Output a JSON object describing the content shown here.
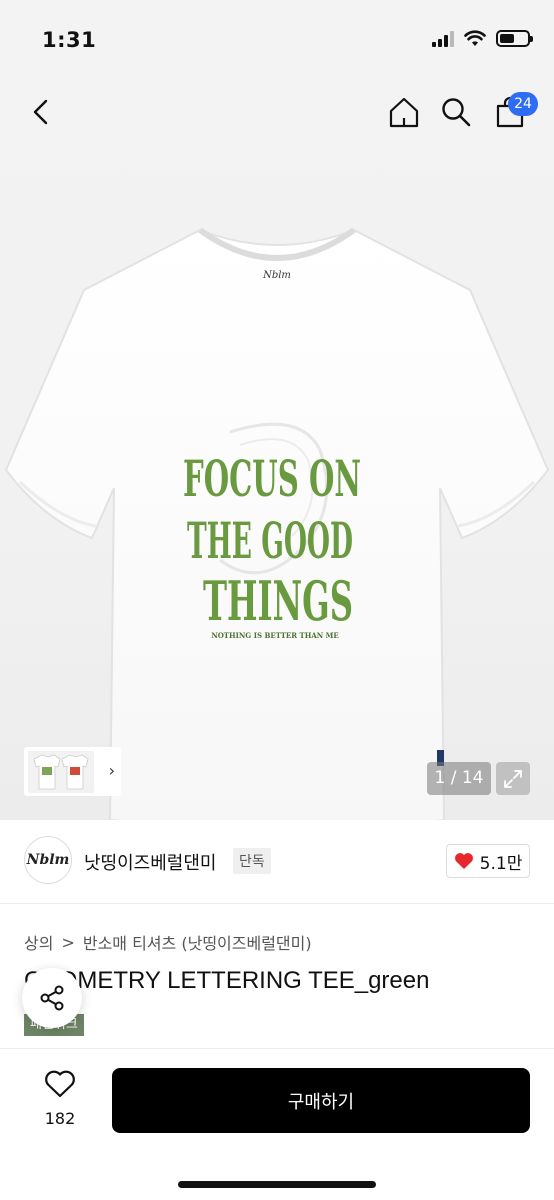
{
  "status_bar": {
    "time": "1:31"
  },
  "nav": {
    "cart_count": "24"
  },
  "product_image": {
    "graphic_lines": [
      "FOCUS ON",
      "THE GOOD",
      "THINGS"
    ],
    "graphic_subline": "NOTHING IS BETTER THAN ME",
    "page_counter": "1 / 14",
    "graphic_color": "#6a9a3f"
  },
  "brand": {
    "logo_text": "Nblm",
    "name": "낫띵이즈베럴댄미",
    "tag": "단독",
    "likes": "5.1만"
  },
  "breadcrumb": {
    "category": "상의",
    "separator": ">",
    "subcategory": "반소매 티셔츠 (낫띵이즈베럴댄미)"
  },
  "product": {
    "title": "GEOMETRY LETTERING TEE_green",
    "event_tag": "패션위크"
  },
  "bottom_bar": {
    "wish_count": "182",
    "buy_label": "구매하기"
  },
  "colors": {
    "accent": "#2f6cf6",
    "like_heart": "#e8262b",
    "buy_button": "#000000"
  }
}
